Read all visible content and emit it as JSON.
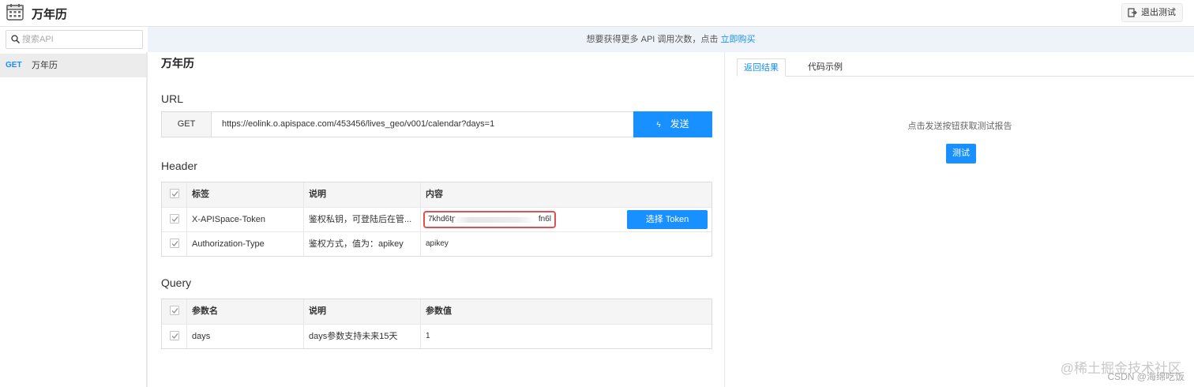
{
  "header": {
    "app_title": "万年历",
    "exit_label": "退出测试"
  },
  "search": {
    "placeholder": "搜索API"
  },
  "notice": {
    "text": "想要获得更多 API 调用次数，点击 ",
    "link": "立即购买"
  },
  "sidebar": {
    "items": [
      {
        "method": "GET",
        "name": "万年历"
      }
    ]
  },
  "main": {
    "title": "万年历",
    "url_section": "URL",
    "method": "GET",
    "url": "https://eolink.o.apispace.com/453456/lives_geo/v001/calendar?days=1",
    "send_label": "发送",
    "header_section": "Header",
    "header_table": {
      "columns": [
        "标签",
        "说明",
        "内容"
      ],
      "rows": [
        {
          "tag": "X-APISpace-Token",
          "desc": "鉴权私钥，可登陆后在管...",
          "value_start": "7khd6tp",
          "value_end": "fn6l",
          "button": "选择 Token"
        },
        {
          "tag": "Authorization-Type",
          "desc": "鉴权方式，值为：apikey",
          "value": "apikey"
        }
      ]
    },
    "query_section": "Query",
    "query_table": {
      "columns": [
        "参数名",
        "说明",
        "参数值"
      ],
      "rows": [
        {
          "name": "days",
          "desc": "days参数支持未来15天",
          "value": "1"
        }
      ]
    }
  },
  "right": {
    "tabs": [
      "返回结果",
      "代码示例"
    ],
    "active_tab": "返回结果",
    "hint": "点击发送按钮获取测试报告",
    "test_label": "测试"
  },
  "watermark": {
    "line1": "@稀土掘金技术社区",
    "line2": "CSDN @海绵吃饭"
  },
  "colors": {
    "accent": "#1890ff",
    "highlight_border": "#e05050",
    "notice_bg": "#eef3fa"
  }
}
